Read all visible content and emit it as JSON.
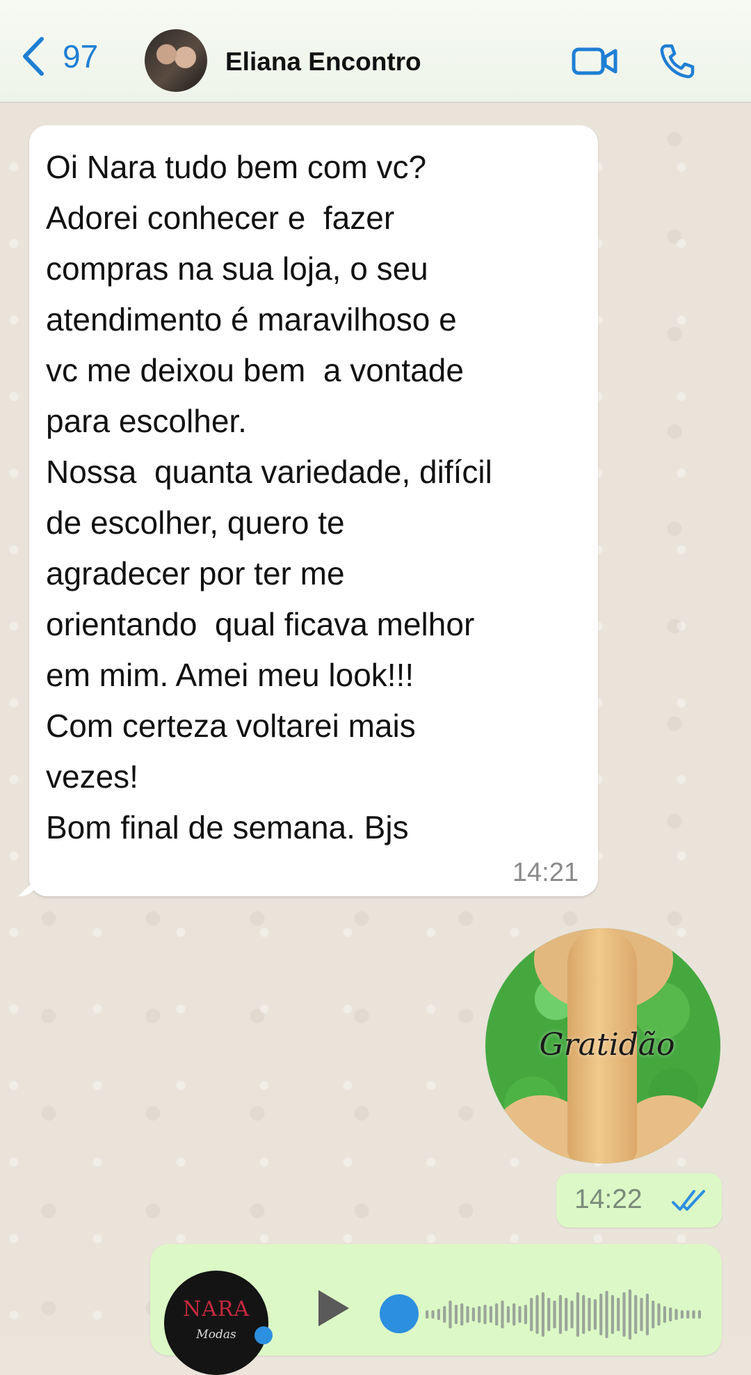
{
  "header": {
    "back_count": "97",
    "contact_name": "Eliana Encontro"
  },
  "incoming_message": {
    "lines": [
      "Oi Nara tudo bem com vc?",
      "Adorei conhecer e  fazer",
      "compras na sua loja, o seu",
      "atendimento é maravilhoso e",
      "vc me deixou bem  a vontade",
      "para escolher.",
      "Nossa  quanta variedade, difícil",
      "de escolher, quero te",
      "agradecer por ter me",
      "orientando  qual ficava melhor",
      "em mim. Amei meu look!!!",
      "Com certeza voltarei mais",
      "vezes!",
      "Bom final de semana. Bjs"
    ],
    "time": "14:21"
  },
  "sticker": {
    "text": "Gratidão"
  },
  "outgoing_sticker_time": {
    "time": "14:22",
    "status_icon": "double-check-read-icon"
  },
  "audio_message": {
    "avatar_brand": "NARA",
    "avatar_brand_sub": "Modas",
    "waveform_levels": [
      0.15,
      0.15,
      0.2,
      0.3,
      0.5,
      0.35,
      0.4,
      0.3,
      0.25,
      0.3,
      0.35,
      0.3,
      0.4,
      0.5,
      0.3,
      0.4,
      0.3,
      0.35,
      0.6,
      0.7,
      0.8,
      0.6,
      0.5,
      0.7,
      0.6,
      0.5,
      0.8,
      0.7,
      0.6,
      0.55,
      0.75,
      0.85,
      0.7,
      0.6,
      0.8,
      0.9,
      0.7,
      0.6,
      0.75,
      0.5,
      0.4,
      0.3,
      0.25,
      0.2,
      0.15,
      0.15,
      0.15,
      0.15
    ]
  },
  "colors": {
    "accent_blue": "#1f7fd4",
    "outgoing_bubble": "#dcf8c6",
    "incoming_bubble": "#ffffff",
    "chat_background": "#e9e3da"
  }
}
